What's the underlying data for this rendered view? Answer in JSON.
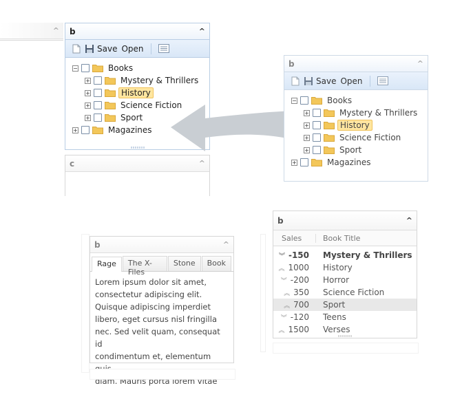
{
  "panel_a_left": {
    "chevron": "^"
  },
  "tree_panel_main": {
    "title": "b",
    "chevron": "^",
    "toolbar": {
      "save_label": "Save",
      "open_label": "Open"
    },
    "tree": [
      {
        "label": "Books",
        "level": 0,
        "expander": "−",
        "selected": false
      },
      {
        "label": "Mystery & Thrillers",
        "level": 1,
        "expander": "+",
        "selected": false
      },
      {
        "label": "History",
        "level": 1,
        "expander": "+",
        "selected": true
      },
      {
        "label": "Science Fiction",
        "level": 1,
        "expander": "+",
        "selected": false
      },
      {
        "label": "Sport",
        "level": 1,
        "expander": "+",
        "selected": false
      },
      {
        "label": "Magazines",
        "level": 0,
        "expander": "+",
        "selected": false
      }
    ]
  },
  "panel_c": {
    "title": "c",
    "chevron": "^"
  },
  "tree_panel_right": {
    "title": "b",
    "chevron": "^",
    "toolbar": {
      "save_label": "Save",
      "open_label": "Open"
    },
    "tree": [
      {
        "label": "Books",
        "level": 0,
        "expander": "−",
        "selected": false
      },
      {
        "label": "Mystery & Thrillers",
        "level": 1,
        "expander": "+",
        "selected": false
      },
      {
        "label": "History",
        "level": 1,
        "expander": "+",
        "selected": true
      },
      {
        "label": "Science Fiction",
        "level": 1,
        "expander": "+",
        "selected": false
      },
      {
        "label": "Sport",
        "level": 1,
        "expander": "+",
        "selected": false
      },
      {
        "label": "Magazines",
        "level": 0,
        "expander": "+",
        "selected": false
      }
    ]
  },
  "tabs_panel": {
    "title": "b",
    "chevron": "^",
    "tabs": [
      "Rage",
      "The X-Files",
      "Stone",
      "Book"
    ],
    "active_tab": 0,
    "body_lines": [
      "Lorem ipsum dolor sit amet,",
      "consectetur adipiscing elit.",
      "Quisque adipiscing imperdiet",
      "libero, eget cursus nisl fringilla",
      "nec. Sed velit quam, consequat id",
      "condimentum et, elementum quis",
      "diam. Mauris porta lorem vitae"
    ]
  },
  "grid_panel": {
    "title": "b",
    "chevron": "^",
    "columns": [
      "Sales",
      "Book Title"
    ],
    "rows": [
      {
        "trend": "down",
        "sales": "-150",
        "title": "Mystery & Thrillers",
        "bold": true,
        "highlight": false
      },
      {
        "trend": "up",
        "sales": "1000",
        "title": "History",
        "bold": false,
        "highlight": false
      },
      {
        "trend": "down",
        "sales": "-200",
        "title": "Horror",
        "bold": false,
        "highlight": false
      },
      {
        "trend": "up",
        "sales": "350",
        "title": "Science Fiction",
        "bold": false,
        "highlight": false
      },
      {
        "trend": "up",
        "sales": "700",
        "title": "Sport",
        "bold": false,
        "highlight": true
      },
      {
        "trend": "down",
        "sales": "-120",
        "title": "Teens",
        "bold": false,
        "highlight": false
      },
      {
        "trend": "up",
        "sales": "1500",
        "title": "Verses",
        "bold": false,
        "highlight": false
      }
    ]
  },
  "icons": {
    "new": "new-document-icon",
    "save": "save-icon",
    "view": "list-view-icon",
    "folder": "folder-icon",
    "arrow": "move-arrow-icon",
    "trend_up": "double-chevron-up-icon",
    "trend_down": "double-chevron-down-icon"
  },
  "colors": {
    "accent_border": "#b8cde4",
    "toolbar_bg": "#dde9f8",
    "selection_bg": "#ffe6a0",
    "folder": "#f3c75a",
    "arrow": "#c9ced3"
  }
}
